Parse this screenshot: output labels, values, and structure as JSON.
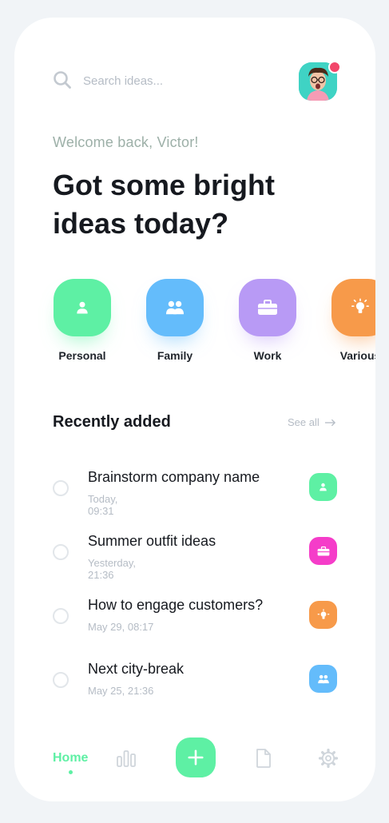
{
  "search": {
    "placeholder": "Search ideas..."
  },
  "greeting": "Welcome back, Victor!",
  "headline_line1": "Got some bright",
  "headline_line2": "ideas today?",
  "categories": [
    {
      "label": "Personal",
      "color": "#5ef0a4",
      "icon": "person-icon"
    },
    {
      "label": "Family",
      "color": "#64bcfb",
      "icon": "family-icon"
    },
    {
      "label": "Work",
      "color": "#b89af5",
      "icon": "briefcase-icon"
    },
    {
      "label": "Various",
      "color": "#f79a4a",
      "icon": "lightbulb-icon"
    }
  ],
  "recent": {
    "title": "Recently added",
    "see_all": "See all",
    "items": [
      {
        "title": "Brainstorm company name",
        "time": "Today, 09:31",
        "badge_color": "#5ef0a4",
        "badge_icon": "person-icon"
      },
      {
        "title": "Summer outfit ideas",
        "time": "Yesterday, 21:36",
        "badge_color": "#f53dc9",
        "badge_icon": "briefcase-icon"
      },
      {
        "title": "How to engage customers?",
        "time": "May 29, 08:17",
        "badge_color": "#f79a4a",
        "badge_icon": "lightbulb-icon"
      },
      {
        "title": "Next city-break",
        "time": "May 25, 21:36",
        "badge_color": "#64bcfb",
        "badge_icon": "family-icon"
      }
    ]
  },
  "nav": {
    "home_label": "Home",
    "accent_color": "#5ef0a4"
  }
}
